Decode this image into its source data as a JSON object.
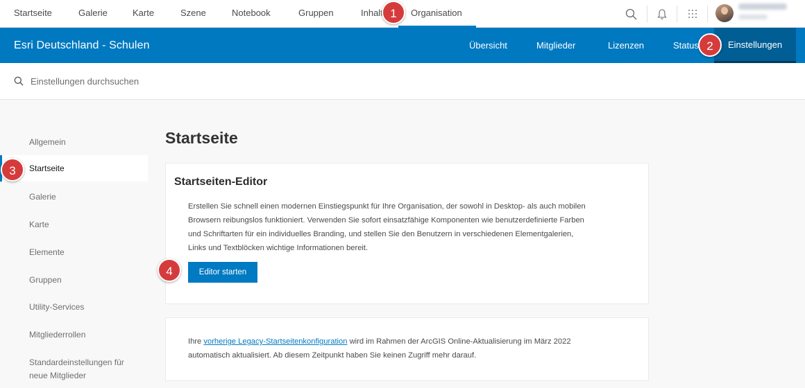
{
  "topnav": {
    "items": [
      "Startseite",
      "Galerie",
      "Karte",
      "Szene",
      "Notebook",
      "Gruppen",
      "Inhalt",
      "Organisation"
    ],
    "active": "Organisation"
  },
  "icons": {
    "search": "search-icon",
    "notifications": "bell-icon",
    "apps": "app-grid-icon",
    "user": "avatar"
  },
  "orgbar": {
    "title": "Esri Deutschland - Schulen",
    "tabs": [
      "Übersicht",
      "Mitglieder",
      "Lizenzen",
      "Status",
      "Einstellungen"
    ],
    "active": "Einstellungen"
  },
  "search": {
    "placeholder": "Einstellungen durchsuchen"
  },
  "sidebar": {
    "items": [
      "Allgemein",
      "Startseite",
      "Galerie",
      "Karte",
      "Elemente",
      "Gruppen",
      "Utility-Services",
      "Mitgliederrollen",
      "Standardeinstellungen für",
      "neue Mitglieder"
    ],
    "active": "Startseite"
  },
  "main": {
    "title": "Startseite",
    "editor_card": {
      "title": "Startseiten-Editor",
      "lines": [
        "Erstellen Sie schnell einen modernen Einstiegspunkt für Ihre Organisation, der sowohl in Desktop- als auch mobilen",
        "Browsern reibungslos funktioniert. Verwenden Sie sofort einsatzfähige Komponenten wie benutzerdefinierte Farben",
        "und Schriftarten für ein individuelles Branding, und stellen Sie den Benutzern in verschiedenen Elementgalerien,",
        "Links und Textblöcken wichtige Informationen bereit."
      ],
      "button": "Editor starten"
    },
    "legacy_card": {
      "prefix": "Ihre ",
      "link": "vorherige Legacy-Startseitenkonfiguration",
      "suffix": " wird im Rahmen der ArcGIS Online-Aktualisierung im März 2022",
      "line2": "automatisch aktualisiert. Ab diesem Zeitpunkt haben Sie keinen Zugriff mehr darauf."
    }
  },
  "badges": [
    "1",
    "2",
    "3",
    "4"
  ],
  "colors": {
    "brand_blue": "#0079c1",
    "active_tab": "#005e95",
    "badge_red": "#d63b3b",
    "button_blue": "#007ac2"
  }
}
